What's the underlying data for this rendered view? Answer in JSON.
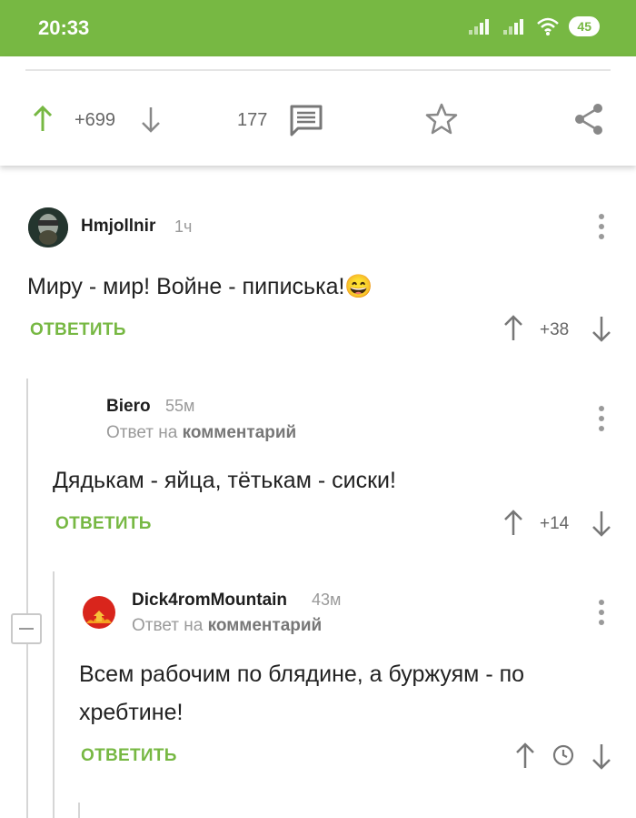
{
  "statusbar": {
    "time": "20:33",
    "battery": "45",
    "icons": [
      "signal-icon",
      "signal-icon",
      "wifi-icon",
      "battery-icon"
    ]
  },
  "post_actions": {
    "rating": "+699",
    "comments_count": "177",
    "icons": [
      "upvote-arrow-icon",
      "downvote-arrow-icon",
      "comment-icon",
      "star-icon",
      "share-icon"
    ]
  },
  "comments": [
    {
      "author": "Hmjollnir",
      "time": "1ч",
      "text": "Миру - мир! Войне - пиписька!😄",
      "reply_label": "ОТВЕТИТЬ",
      "rating": "+38"
    },
    {
      "author": "Biero",
      "time": "55м",
      "reply_to_prefix": "Ответ на",
      "reply_to_link": "комментарий",
      "text": "Дядькам - яйца, тётькам - сиски!",
      "reply_label": "ОТВЕТИТЬ",
      "rating": "+14"
    },
    {
      "author": "Dick4romMountain",
      "time": "43м",
      "reply_to_prefix": "Ответ на",
      "reply_to_link": "комментарий",
      "text_line1": "Всем рабочим по блядине, а буржуям - по",
      "text_line2": "хребтине!",
      "reply_label": "ОТВЕТИТЬ",
      "rating_icon": "clock-icon"
    }
  ],
  "colors": {
    "accent": "#77b843",
    "text": "#222222",
    "muted": "#9a9a9a"
  }
}
